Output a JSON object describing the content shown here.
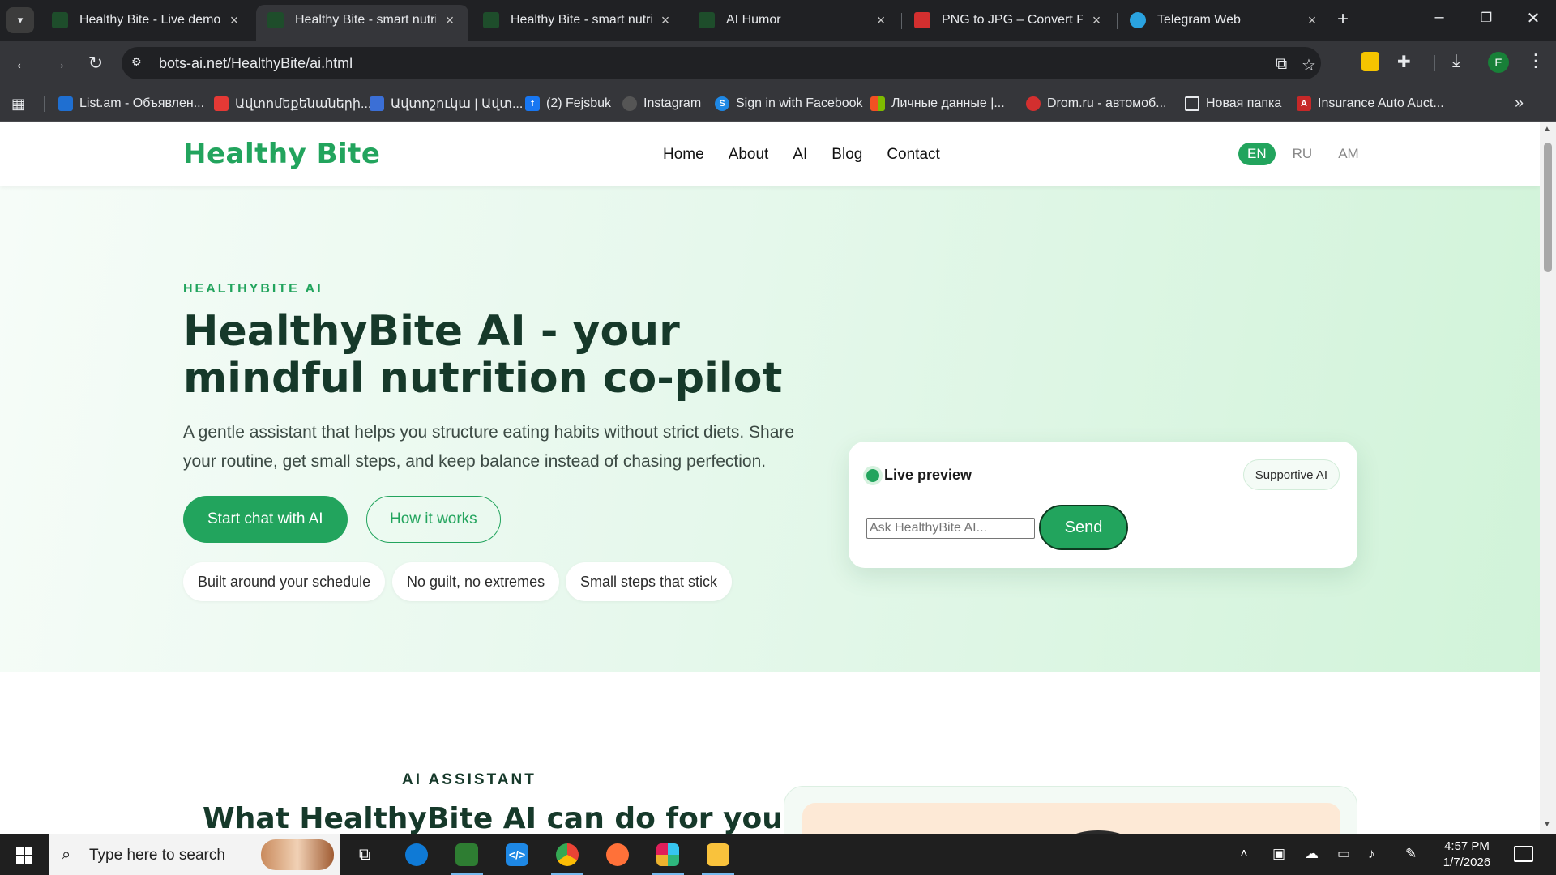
{
  "browser": {
    "tabs": [
      {
        "title": "Healthy Bite - Live demo | AI",
        "active": false,
        "favicon_color": "#1e4d2b"
      },
      {
        "title": "Healthy Bite - smart nutrition",
        "active": true,
        "favicon_color": "#1e4d2b"
      },
      {
        "title": "Healthy Bite - smart nutrition",
        "active": false,
        "favicon_color": "#1e4d2b"
      },
      {
        "title": "AI Humor",
        "active": false,
        "favicon_color": "#1e4d2b"
      },
      {
        "title": "PNG to JPG – Convert PNG",
        "active": false,
        "favicon_color": "#d32f2f"
      },
      {
        "title": "Telegram Web",
        "active": false,
        "favicon_color": "#2aa3e0"
      }
    ],
    "url": "bots-ai.net/HealthyBite/ai.html",
    "profile_initial": "E",
    "bookmarks": [
      {
        "label": "List.am - Объявлен...",
        "color": "#1f6fd1"
      },
      {
        "label": "Ավտոմեքենաների...",
        "color": "#e53935"
      },
      {
        "label": "Ավտոշուկա | Ավտ...",
        "color": "#3b6fd6"
      },
      {
        "label": "(2) Fejsbuk",
        "color": "#1877f2"
      },
      {
        "label": "Instagram",
        "color": "#555555"
      },
      {
        "label": "Sign in with Facebook",
        "color": "#1e88e5"
      },
      {
        "label": "Личные данные |...",
        "color": "#f25022"
      },
      {
        "label": "Drom.ru - автомоб...",
        "color": "#d32f2f"
      },
      {
        "label": "Новая папка",
        "color": "#35363a"
      },
      {
        "label": "Insurance Auto Auct...",
        "color": "#c62828"
      }
    ]
  },
  "site": {
    "logo": "Healthy Bite",
    "nav": [
      "Home",
      "About",
      "AI",
      "Blog",
      "Contact"
    ],
    "languages": [
      "EN",
      "RU",
      "AM"
    ],
    "active_language": "EN",
    "accent": "#22a45d"
  },
  "hero": {
    "eyebrow": "HEALTHYBITE AI",
    "title": "HealthyBite AI - your mindful nutrition co-pilot",
    "lead": "A gentle assistant that helps you structure eating habits without strict diets. Share your routine, get small steps, and keep balance instead of chasing perfection.",
    "primary_cta": "Start chat with AI",
    "secondary_cta": "How it works",
    "chips": [
      "Built around your schedule",
      "No guilt, no extremes",
      "Small steps that stick"
    ]
  },
  "preview": {
    "title": "Live preview",
    "badge": "Supportive AI",
    "input_placeholder": "Ask HealthyBite AI...",
    "send_label": "Send"
  },
  "section2": {
    "eyebrow": "AI ASSISTANT",
    "title": "What HealthyBite AI can do for you"
  },
  "taskbar": {
    "search_placeholder": "Type here to search",
    "time": "4:57 PM",
    "date": "1/7/2026"
  }
}
